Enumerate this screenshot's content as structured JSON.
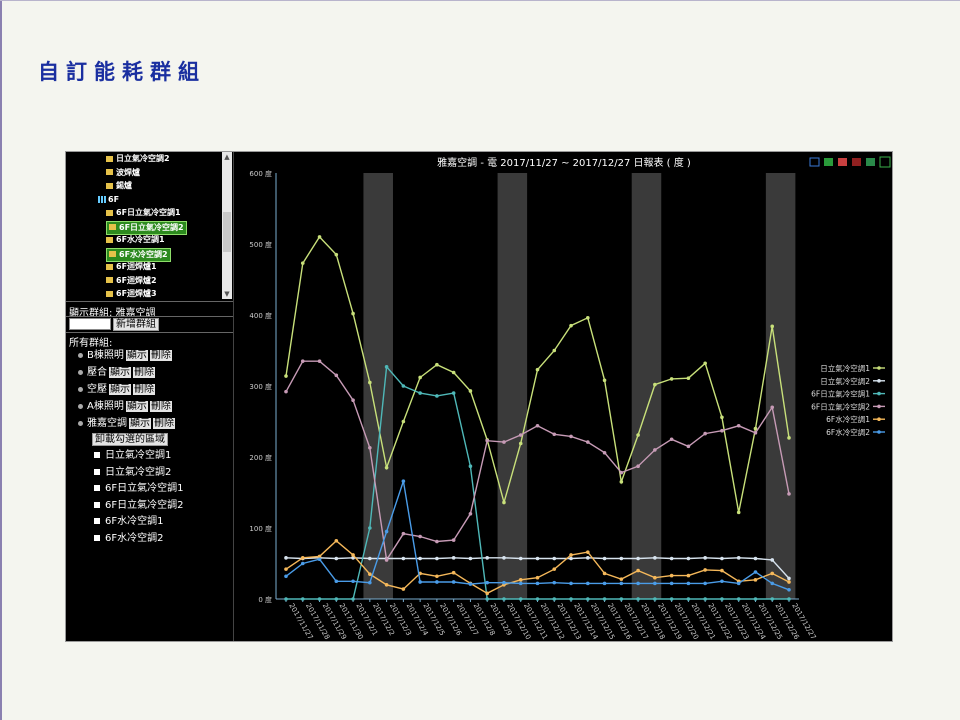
{
  "slide": {
    "title": "自訂能耗群組"
  },
  "tree": {
    "items": [
      {
        "label": "日立氣冷空調2",
        "type": "folder",
        "indent": 1
      },
      {
        "label": "波焊爐",
        "type": "folder",
        "indent": 1
      },
      {
        "label": "錫爐",
        "type": "folder",
        "indent": 1
      },
      {
        "label": "6F",
        "type": "floor",
        "indent": 0
      },
      {
        "label": "6F日立氣冷空調1",
        "type": "folder",
        "indent": 1
      },
      {
        "label": "6F日立氣冷空調2",
        "type": "folder",
        "indent": 1,
        "selected": true
      },
      {
        "label": "6F水冷空調1",
        "type": "folder",
        "indent": 1
      },
      {
        "label": "6F水冷空調2",
        "type": "folder",
        "indent": 1,
        "selected": true
      },
      {
        "label": "6F迴焊爐1",
        "type": "folder",
        "indent": 1
      },
      {
        "label": "6F迴焊爐2",
        "type": "folder",
        "indent": 1
      },
      {
        "label": "6F迴焊爐3",
        "type": "folder",
        "indent": 1
      }
    ]
  },
  "sidebar": {
    "display_group_label": "顯示群組: 雅嘉空調",
    "new_group_placeholder": "",
    "new_group_button": "新增群組",
    "all_groups_label": "所有群組:",
    "show_label": "顯示",
    "delete_label": "刪除",
    "groups": [
      "B棟照明",
      "壓合",
      "空壓",
      "A棟照明",
      "雅嘉空調"
    ],
    "unload_button": "卸載勾選的區域",
    "members": [
      "日立氣冷空調1",
      "日立氣冷空調2",
      "6F日立氣冷空調1",
      "6F日立氣冷空調2",
      "6F水冷空調1",
      "6F水冷空調2"
    ]
  },
  "chart_data": {
    "type": "line",
    "title": "雅嘉空調 - 電 2017/11/27 ~ 2017/12/27 日報表 ( 度 )",
    "y_unit": "度",
    "ylim": [
      0,
      600
    ],
    "yticks": [
      0,
      100,
      200,
      300,
      400,
      500,
      600
    ],
    "grid": false,
    "legend_position": "right",
    "weekend_bands": [
      [
        5,
        6
      ],
      [
        13,
        14
      ],
      [
        21,
        22
      ],
      [
        29,
        30
      ]
    ],
    "categories": [
      "2017/11/27",
      "2017/11/28",
      "2017/11/29",
      "2017/11/30",
      "2017/12/1",
      "2017/12/2",
      "2017/12/3",
      "2017/12/4",
      "2017/12/5",
      "2017/12/6",
      "2017/12/7",
      "2017/12/8",
      "2017/12/9",
      "2017/12/10",
      "2017/12/11",
      "2017/12/12",
      "2017/12/13",
      "2017/12/14",
      "2017/12/15",
      "2017/12/16",
      "2017/12/17",
      "2017/12/18",
      "2017/12/19",
      "2017/12/20",
      "2017/12/21",
      "2017/12/22",
      "2017/12/23",
      "2017/12/24",
      "2017/12/25",
      "2017/12/26",
      "2017/12/27"
    ],
    "series": [
      {
        "name": "日立氣冷空調1",
        "color": "#c8e07a",
        "values": [
          314,
          473,
          510,
          485,
          402,
          305,
          185,
          250,
          312,
          330,
          319,
          293,
          224,
          136,
          219,
          323,
          350,
          385,
          396,
          308,
          165,
          231,
          302,
          310,
          311,
          332,
          256,
          122,
          240,
          384,
          227
        ]
      },
      {
        "name": "日立氣冷空調2",
        "color": "#d7e3ee",
        "values": [
          58,
          57,
          58,
          57,
          58,
          57,
          57,
          57,
          57,
          57,
          58,
          57,
          58,
          58,
          57,
          57,
          57,
          57,
          58,
          57,
          57,
          57,
          58,
          57,
          57,
          58,
          57,
          58,
          57,
          55,
          29
        ]
      },
      {
        "name": "6F日立氣冷空調1",
        "color": "#4fb8b8",
        "values": [
          0,
          0,
          0,
          0,
          0,
          100,
          327,
          300,
          290,
          286,
          290,
          187,
          0,
          0,
          0,
          0,
          0,
          0,
          0,
          0,
          0,
          0,
          0,
          0,
          0,
          0,
          0,
          0,
          0,
          0,
          0
        ]
      },
      {
        "name": "6F日立氣冷空調2",
        "color": "#c79bb6",
        "values": [
          292,
          335,
          335,
          315,
          280,
          213,
          55,
          92,
          88,
          81,
          83,
          120,
          223,
          221,
          231,
          244,
          232,
          229,
          221,
          206,
          178,
          187,
          210,
          225,
          215,
          233,
          237,
          244,
          234,
          270,
          148
        ]
      },
      {
        "name": "6F水冷空調1",
        "color": "#f5b85a",
        "values": [
          42,
          58,
          60,
          82,
          62,
          35,
          20,
          14,
          36,
          32,
          37,
          22,
          8,
          20,
          27,
          30,
          42,
          62,
          66,
          36,
          28,
          40,
          30,
          33,
          33,
          41,
          40,
          25,
          27,
          36,
          24
        ]
      },
      {
        "name": "6F水冷空調2",
        "color": "#4a9ce8",
        "values": [
          32,
          50,
          56,
          25,
          25,
          23,
          95,
          166,
          24,
          24,
          24,
          21,
          23,
          23,
          22,
          22,
          23,
          22,
          22,
          22,
          22,
          22,
          22,
          22,
          22,
          22,
          25,
          22,
          38,
          22,
          13
        ]
      }
    ]
  }
}
